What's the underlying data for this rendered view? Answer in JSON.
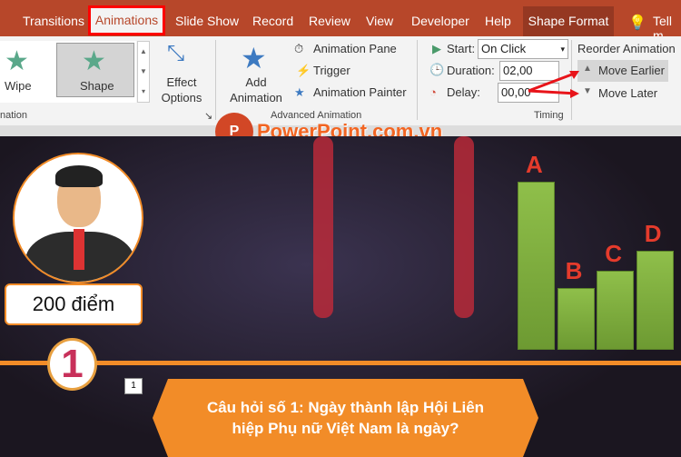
{
  "tabs": [
    "Transitions",
    "Animations",
    "Slide Show",
    "Record",
    "Review",
    "View",
    "Developer",
    "Help",
    "Shape Format",
    "Tell m"
  ],
  "gallery": {
    "wipe": "Wipe",
    "shape": "Shape",
    "group": "nation"
  },
  "effect_options": "Effect Options",
  "advanced": {
    "add_animation": "Add Animation",
    "pane": "Animation Pane",
    "trigger": "Trigger",
    "painter": "Animation Painter",
    "group": "Advanced Animation"
  },
  "timing": {
    "start_label": "Start:",
    "start_value": "On Click",
    "duration_label": "Duration:",
    "duration_value": "02,00",
    "delay_label": "Delay:",
    "delay_value": "00,00",
    "group": "Timing"
  },
  "reorder": {
    "title": "Reorder Animation",
    "earlier": "Move Earlier",
    "later": "Move Later"
  },
  "watermark": "PowerPoint.com.vn",
  "slide": {
    "score": "200 điểm",
    "badge_number": "1",
    "question_number": "1",
    "question": "Câu hỏi số 1: Ngày thành lập Hội Liên hiệp Phụ nữ Việt Nam là ngày?"
  },
  "chart_data": {
    "type": "bar",
    "categories": [
      "A",
      "B",
      "C",
      "D"
    ],
    "values": [
      100,
      37,
      47,
      59
    ],
    "ylim": [
      0,
      100
    ]
  },
  "colors": {
    "accent": "#b7472a",
    "question_bg": "#f28c28",
    "bars": "#8fbf4a",
    "labels": "#e53b2c"
  }
}
